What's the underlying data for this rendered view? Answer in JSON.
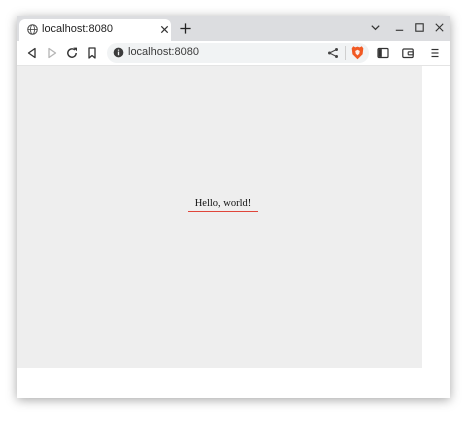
{
  "tab": {
    "title": "localhost:8080",
    "favicon_icon": "globe-icon",
    "close_icon": "close-icon"
  },
  "tabstrip": {
    "new_tab_icon": "plus-icon",
    "tab_search_icon": "chevron-down-icon",
    "minimize_icon": "minimize-icon",
    "maximize_icon": "maximize-icon",
    "close_window_icon": "close-icon"
  },
  "toolbar": {
    "back_icon": "back-icon",
    "forward_icon": "forward-icon",
    "reload_icon": "reload-icon",
    "bookmark_icon": "bookmark-icon",
    "sidebar_icon": "sidebar-icon",
    "wallet_icon": "wallet-icon",
    "menu_icon": "menu-icon"
  },
  "omnibox": {
    "url": "localhost:8080",
    "info_icon": "info-icon",
    "share_icon": "share-icon",
    "shields_icon": "brave-shields-icon"
  },
  "page": {
    "greeting": "Hello, world!"
  },
  "colors": {
    "tabstrip_bg": "#dcdde0",
    "canvas_bg": "#eeeeee",
    "underline": "#e0453a",
    "brave_orange": "#f15a24"
  }
}
